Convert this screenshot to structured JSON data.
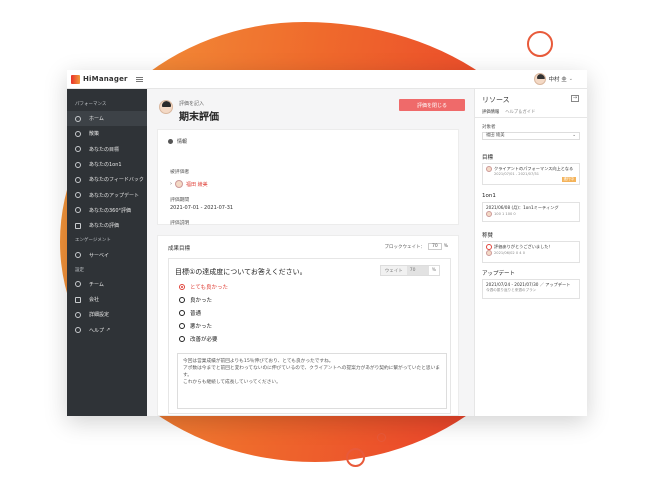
{
  "app": {
    "logo": "HiManager"
  },
  "user": {
    "name": "中村 圭"
  },
  "sidebar": {
    "sections": [
      "パフォーマンス",
      "エンゲージメント",
      "設定"
    ],
    "items": [
      {
        "label": "ホーム",
        "icon": "home-icon"
      },
      {
        "label": "散策",
        "icon": "compass-icon"
      },
      {
        "label": "あなたの目標",
        "icon": "target-icon"
      },
      {
        "label": "あなたの1on1",
        "icon": "chat-icon"
      },
      {
        "label": "あなたのフィードバック",
        "icon": "feedback-icon"
      },
      {
        "label": "あなたのアップデート",
        "icon": "update-icon"
      },
      {
        "label": "あなたの360°評価",
        "icon": "review360-icon"
      },
      {
        "label": "あなたの評価",
        "icon": "evaluation-icon"
      },
      {
        "label": "サーベイ",
        "icon": "survey-icon"
      },
      {
        "label": "チーム",
        "icon": "team-icon"
      },
      {
        "label": "会社",
        "icon": "company-icon"
      },
      {
        "label": "詳細設定",
        "icon": "settings-icon"
      },
      {
        "label": "ヘルプ",
        "icon": "help-icon"
      }
    ]
  },
  "page": {
    "subtitle": "評価を記入",
    "title": "期末評価",
    "close_button": "評価を閉じる"
  },
  "info": {
    "heading": "情報",
    "evaluatee_label": "被評価者",
    "evaluatee_name": "福田 綾美",
    "period_label": "評価期間",
    "period_value": "2021-07-01 - 2021-07-31",
    "description_label": "評価説明"
  },
  "goal": {
    "title": "成果目標",
    "block_weight_label": "ブロックウェイト：",
    "block_weight_value": "70",
    "block_weight_unit": "%",
    "question": "目標①の達成度についてお答えください。",
    "weight_label": "ウェイト",
    "weight_value": "70",
    "weight_unit": "%",
    "options": [
      {
        "label": "とても良かった",
        "selected": true
      },
      {
        "label": "良かった",
        "selected": false
      },
      {
        "label": "普通",
        "selected": false
      },
      {
        "label": "悪かった",
        "selected": false
      },
      {
        "label": "改善が必要",
        "selected": false
      }
    ],
    "comment_lines": [
      "今回は営業成績が前回よりも15％伸びており、とても良かったですね。",
      "アポ数は今までと前回と変わってないのに伸びているので、クライアントへの提案力があがり契約に繋がっていたと思います。",
      "これからも継続して成長していってください。"
    ]
  },
  "resources": {
    "title": "リソース",
    "tabs": [
      "評価情報",
      "ヘルプ＆ガイド"
    ],
    "subject_label": "対象者",
    "subject_value": "福田 綾美",
    "goals_title": "目標",
    "goal_text": "クライアントのパフォーマンス向上となる",
    "goal_meta": "2021/07/01 - 2021/07/31",
    "goal_badge": "進行中",
    "oneonone_title": "1on1",
    "oneonone_text": "2021/06/08 (月)：1on1ミーティング",
    "oneonone_meta": "100   1   100   0",
    "feedback_title": "称賛",
    "feedback_text": "評価ありがとうございました！",
    "feedback_meta": "2021/06/02   0   4   0",
    "update_title": "アップデート",
    "update_text": "2021/07/24 - 2021/07/30 ／ アップデート",
    "update_meta": "今週の振り返りと来週のプラン"
  },
  "colors": {
    "accent": "#e0433a",
    "sidebar": "#2f3337",
    "button": "#ef6a6a"
  }
}
